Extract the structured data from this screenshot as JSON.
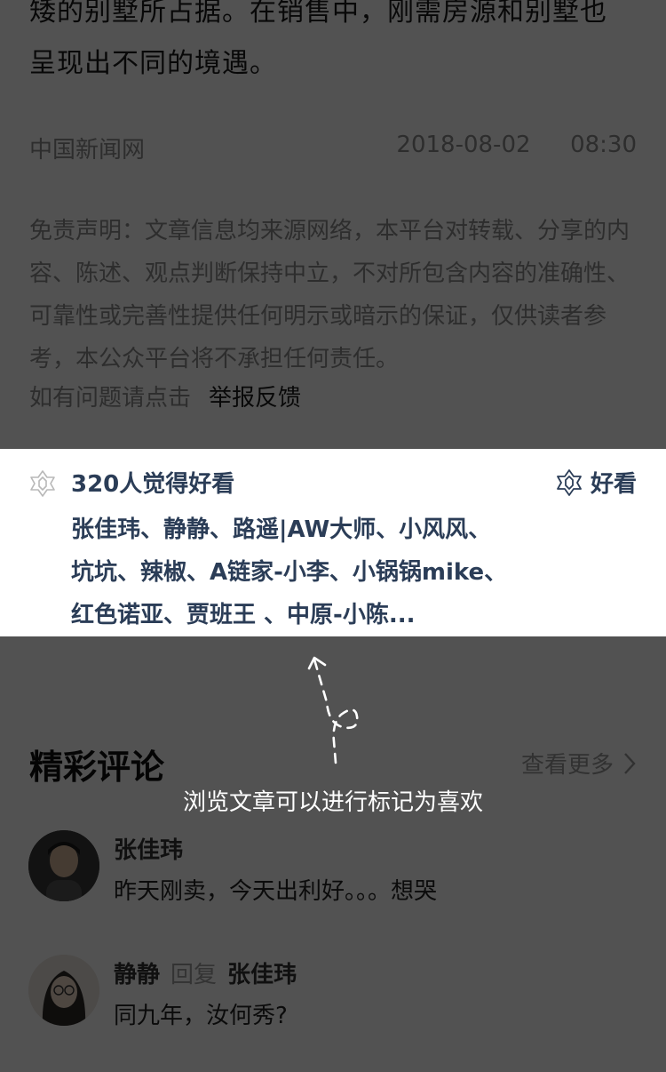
{
  "article": {
    "paragraph_lines": [
      "矮的别墅所占据。在销售中，刚需房源和别墅也",
      "呈现出不同的境遇。"
    ],
    "source": "中国新闻网",
    "date": "2018-08-02",
    "time": "08:30",
    "disclaimer": "免责声明：文章信息均来源网络，本平台对转载、分享的内容、陈述、观点判断保持中立，不对所包含内容的准确性、可靠性或完善性提供任何明示或暗示的保证，仅供读者参考，本公众平台将不承担任何责任。",
    "report_prompt": "如有问题请点击",
    "report_link": "举报反馈"
  },
  "likes": {
    "count_text": "320人觉得好看",
    "button_label": "好看",
    "liker_lines": [
      "张佳玮、静静、路遥|AW大师、小风风、",
      "坑坑、辣椒、A链家-小李、小锅锅mike、",
      "红色诺亚、贾班王 、中原-小陈..."
    ]
  },
  "comments": {
    "title": "精彩评论",
    "more_label": "查看更多",
    "items": [
      {
        "name": "张佳玮",
        "text": "昨天刚卖，今天出利好。。。想哭"
      },
      {
        "name": "静静",
        "reply_word": "回复",
        "reply_to": "张佳玮",
        "text": "同九年，汝何秀?"
      }
    ]
  },
  "hint": {
    "text": "浏览文章可以进行标记为喜欢"
  },
  "colors": {
    "liker_text": "#2b3d57",
    "overlay": "rgba(0,0,0,0.68)"
  }
}
